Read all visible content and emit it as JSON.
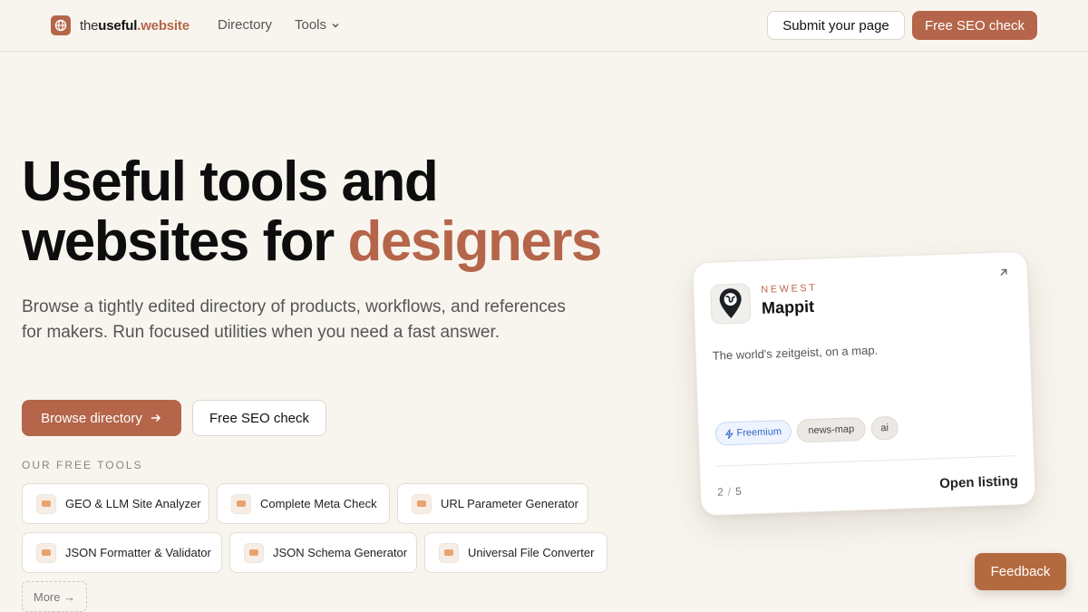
{
  "header": {
    "logo": {
      "prefix": "the",
      "bold": "useful",
      "tld": ".website"
    },
    "nav": {
      "directory": "Directory",
      "tools": "Tools"
    },
    "submit_label": "Submit your page",
    "seo_label": "Free SEO check"
  },
  "hero": {
    "title_line1": "Useful tools and",
    "title_line2": "websites for",
    "title_accent": "designers",
    "subtitle": "Browse a tightly edited directory of products, workflows, and references for makers. Run focused utilities when you need a fast answer.",
    "browse_label": "Browse directory",
    "seo_label": "Free SEO check"
  },
  "tools": {
    "label": "OUR FREE TOOLS",
    "items": [
      "GEO & LLM Site Analyzer",
      "Complete Meta Check",
      "URL Parameter Generator",
      "JSON Formatter & Validator",
      "JSON Schema Generator",
      "Universal File Converter"
    ],
    "more_label": "More →"
  },
  "card": {
    "kicker": "NEWEST",
    "name": "Mappit",
    "description": "The world's zeitgeist, on a map.",
    "tags": [
      "Freemium",
      "news-map",
      "ai"
    ],
    "page_current": "2",
    "page_sep": "/",
    "page_total": "5",
    "open_label": "Open listing"
  },
  "feedback_label": "Feedback",
  "colors": {
    "accent": "#b5654a",
    "background": "#f8f5ef",
    "feedback": "#b46a3f",
    "tag_blue": "#3466c5"
  }
}
